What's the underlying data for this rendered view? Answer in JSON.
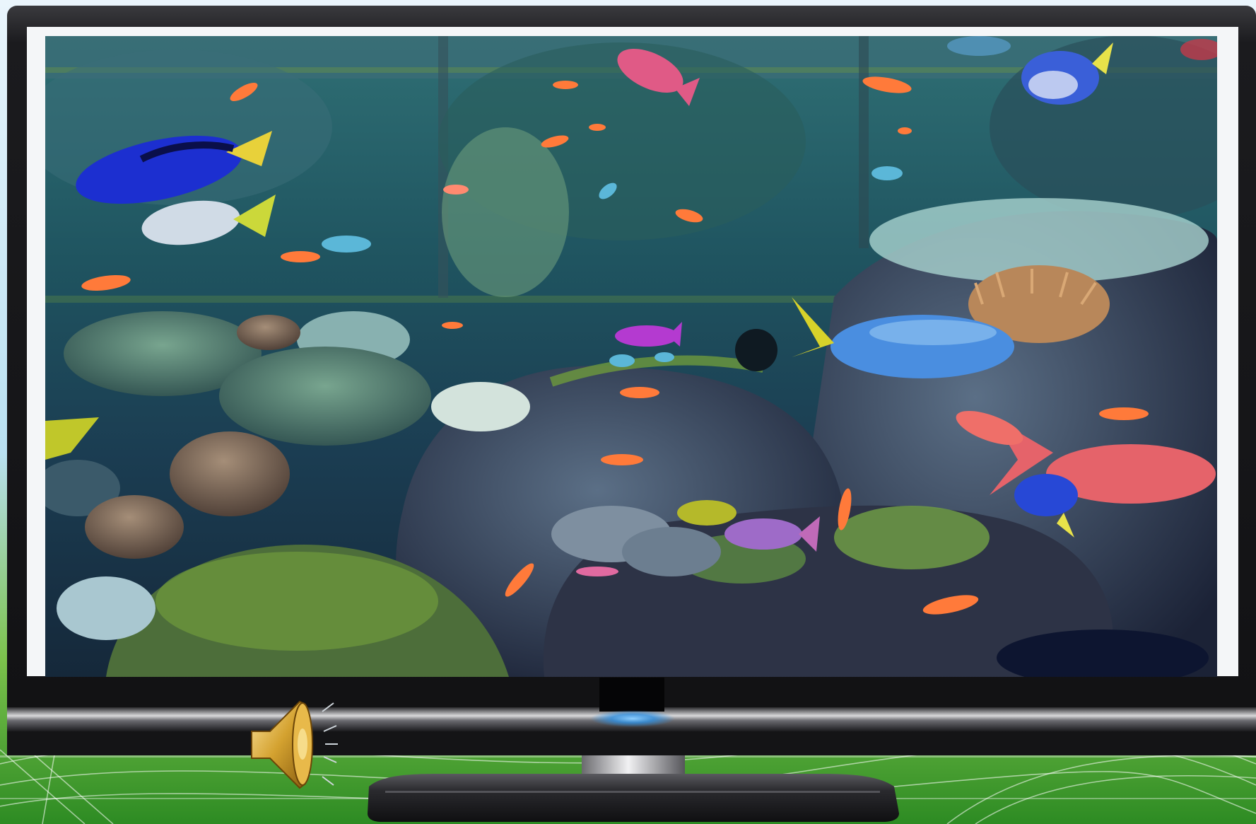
{
  "scene": {
    "subject": "flat-screen-tv-showing-coral-reef-aquarium",
    "background_colors": [
      "#e6f3fb",
      "#a9d8ec",
      "#79c04b",
      "#2e8d22"
    ],
    "bezel_color": "#1c1c1e",
    "screen_frame_color": "#f4f6f8",
    "water_colors": [
      "#1d4a58",
      "#2c6b73",
      "#3f8377",
      "#12283a"
    ],
    "led_color": "#3aa0ff"
  },
  "icons": {
    "speaker": "speaker-volume-icon"
  }
}
